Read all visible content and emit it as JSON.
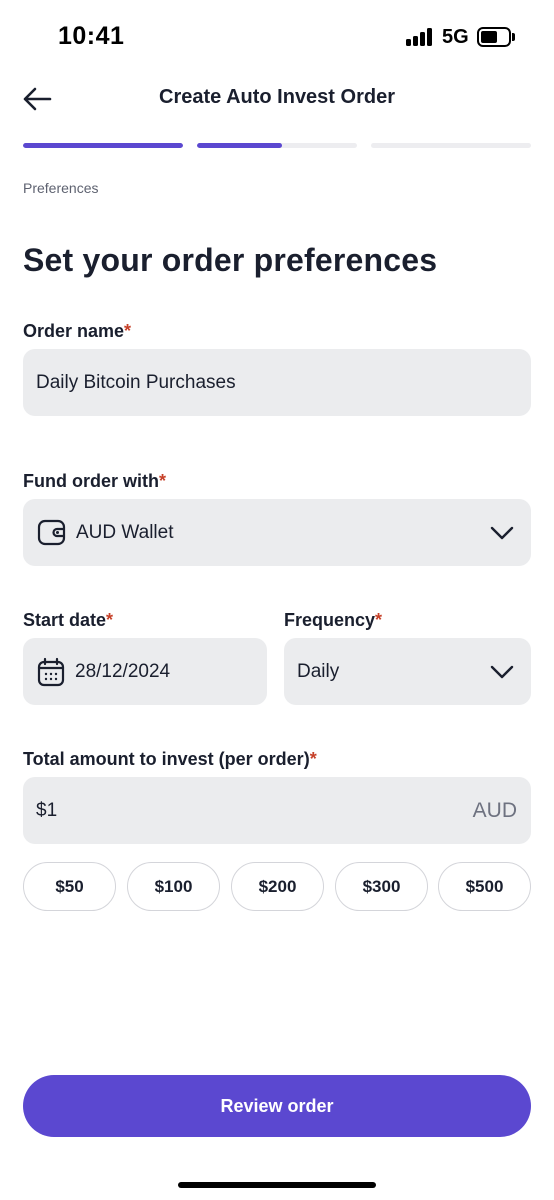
{
  "status_bar": {
    "time": "10:41",
    "network": "5G",
    "battery_level": 0.6
  },
  "header": {
    "title": "Create Auto Invest Order",
    "back_icon": "arrow-left-icon"
  },
  "progress": {
    "steps": [
      {
        "fill": 1.0
      },
      {
        "fill": 0.53
      },
      {
        "fill": 0.0
      }
    ],
    "accent_color": "#5b48d0",
    "track_color": "#ededf0"
  },
  "step_label": "Preferences",
  "page_title": "Set your order preferences",
  "required_marker": "*",
  "order_name": {
    "label": "Order name",
    "value": "Daily Bitcoin Purchases"
  },
  "fund_order": {
    "label": "Fund order with",
    "value": "AUD Wallet",
    "icon": "wallet-icon"
  },
  "start_date": {
    "label": "Start date",
    "value": "28/12/2024",
    "icon": "calendar-icon"
  },
  "frequency": {
    "label": "Frequency",
    "value": "Daily"
  },
  "amount": {
    "label": "Total amount to invest (per order)",
    "value": "$1",
    "currency": "AUD"
  },
  "quick_amounts": [
    "$50",
    "$100",
    "$200",
    "$300",
    "$500"
  ],
  "review_button": {
    "label": "Review order",
    "color": "#5b48d0"
  },
  "colors": {
    "field_background": "#ebecee",
    "required": "#c64028",
    "text": "#1a1f2e"
  }
}
